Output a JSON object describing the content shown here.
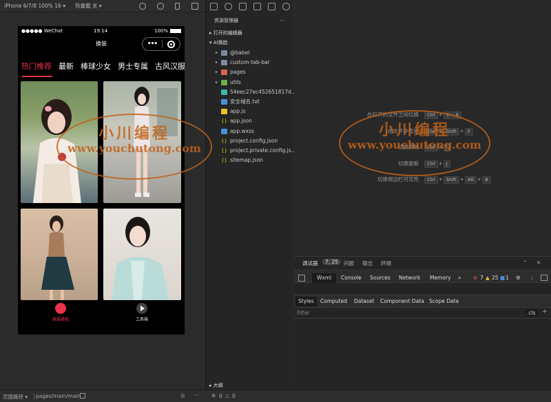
{
  "toolbar": {
    "device": "iPhone 6/7/8 100% 16",
    "hot_reload": "热重载 关"
  },
  "phone": {
    "carrier": "●●●●● WeChat",
    "time": "19:14",
    "battery": "100%",
    "nav_title": "换装",
    "capsule_dots": "•••",
    "tabs": [
      "热门推荐",
      "最新",
      "棒球少女",
      "男士专属",
      "古风汉服"
    ],
    "tabbar": [
      {
        "label": "换装美拍",
        "icon": "swap-icon",
        "color": "#e8334a"
      },
      {
        "label": "工具箱",
        "icon": "play-icon",
        "color": "#ffffff"
      }
    ]
  },
  "explorer": {
    "title": "资源管理器",
    "more": "···",
    "open_editors": "打开的编辑器",
    "project": "AI换脸",
    "outline": "大纲",
    "files": [
      {
        "name": "@babel",
        "type": "folder",
        "color": "#7a8a9a",
        "expandable": true
      },
      {
        "name": "custom-tab-bar",
        "type": "folder",
        "color": "#7a8a9a",
        "expandable": true
      },
      {
        "name": "pages",
        "type": "folder",
        "color": "#d9664a",
        "expandable": true
      },
      {
        "name": "utils",
        "type": "folder",
        "color": "#6ab04c",
        "expandable": true
      },
      {
        "name": "54eec27ec452651817d...",
        "type": "file",
        "color": "#3fb6a8",
        "expandable": false
      },
      {
        "name": "安全域名.txt",
        "type": "file",
        "color": "#4a90d9",
        "expandable": false
      },
      {
        "name": "app.js",
        "type": "file",
        "color": "#e6c229",
        "expandable": false
      },
      {
        "name": "app.json",
        "type": "json",
        "color": "#e6c229",
        "expandable": false
      },
      {
        "name": "app.wxss",
        "type": "file",
        "color": "#4a90d9",
        "expandable": false
      },
      {
        "name": "project.config.json",
        "type": "json",
        "color": "#e6c229",
        "expandable": false
      },
      {
        "name": "project.private.config.js...",
        "type": "json",
        "color": "#e6c229",
        "expandable": false
      },
      {
        "name": "sitemap.json",
        "type": "json",
        "color": "#e6c229",
        "expandable": false
      }
    ]
  },
  "editor": {
    "hints": [
      {
        "label": "在打开的文件之间切换",
        "keys": [
          "Ctrl",
          "1 ~ 9"
        ]
      },
      {
        "label": "在文件中查找",
        "keys": [
          "Ctrl",
          "Shift",
          "F"
        ]
      },
      {
        "label": "切换终端",
        "keys": [
          "Ctrl",
          "`"
        ]
      },
      {
        "label": "切换面板",
        "keys": [
          "Ctrl",
          "J"
        ]
      },
      {
        "label": "切换侧边栏可见性",
        "keys": [
          "Ctrl",
          "Shift",
          "Alt",
          "B"
        ]
      }
    ]
  },
  "debugger": {
    "tab_main": "调试器",
    "badge": "7, 25",
    "tab_problems": "问题",
    "tab_output": "输出",
    "tab_terminal": "终端",
    "devtools_tabs": [
      "Wxml",
      "Console",
      "Sources",
      "Network",
      "Memory"
    ],
    "more": "»",
    "errors": "7",
    "warnings": "25",
    "infos": "1",
    "style_tabs": [
      "Styles",
      "Computed",
      "Dataset",
      "Component Data",
      "Scope Data"
    ],
    "filter_placeholder": "Filter",
    "cls": ".cls",
    "plus": "+"
  },
  "statusbar": {
    "page_path_label": "页面路径",
    "page_path": "pages/main/main",
    "errors": "0",
    "warnings": "0"
  },
  "watermark": {
    "cn": "小川编程",
    "url": "www.youchutong.com"
  }
}
